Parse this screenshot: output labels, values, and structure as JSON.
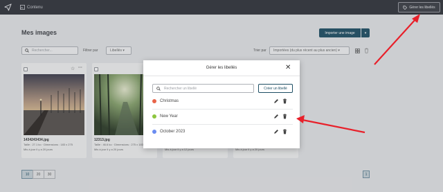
{
  "topbar": {
    "content_label": "Contenu",
    "manage_tags_label": "Gérer les libellés"
  },
  "page": {
    "title": "Mes images",
    "import_label": "Importer une image",
    "search_placeholder": "Rechercher...",
    "filter_label": "Filtrer par",
    "filter_value": "Libellés",
    "sort_label": "Trier par",
    "sort_value": "Importées (du plus récent au plus ancien)"
  },
  "cards": [
    {
      "name": "1434243434.jpg",
      "meta": "Taille : 27.1 ko · Dimensions : 183 x 275",
      "added": "Mis à jour il y a 20 jours"
    },
    {
      "name": "12313.jpg",
      "meta": "Taille : 46.6 ko · Dimensions : 275 x 183",
      "added": "Mis à jour il y a 20 jours"
    },
    {
      "name": "",
      "meta": "",
      "added": "Mis à jour il y a 12 jours"
    },
    {
      "name": "",
      "meta": "",
      "added": "Mis à jour il y a 20 jours"
    }
  ],
  "pagination": {
    "per_page": [
      "10",
      "20",
      "30"
    ],
    "current_page": "1"
  },
  "modal": {
    "title": "Gérer les libellés",
    "search_placeholder": "Rechercher un libellé",
    "create_label": "Créer un libellé",
    "tags": [
      {
        "label": "Christmas",
        "color": "#e8644a"
      },
      {
        "label": "New Year",
        "color": "#8dc63f"
      },
      {
        "label": "October 2023",
        "color": "#6b8cf0"
      }
    ]
  },
  "colors": {
    "topbar": "#2f3139",
    "primary": "#1d4e63",
    "annotation": "#e8202a"
  }
}
